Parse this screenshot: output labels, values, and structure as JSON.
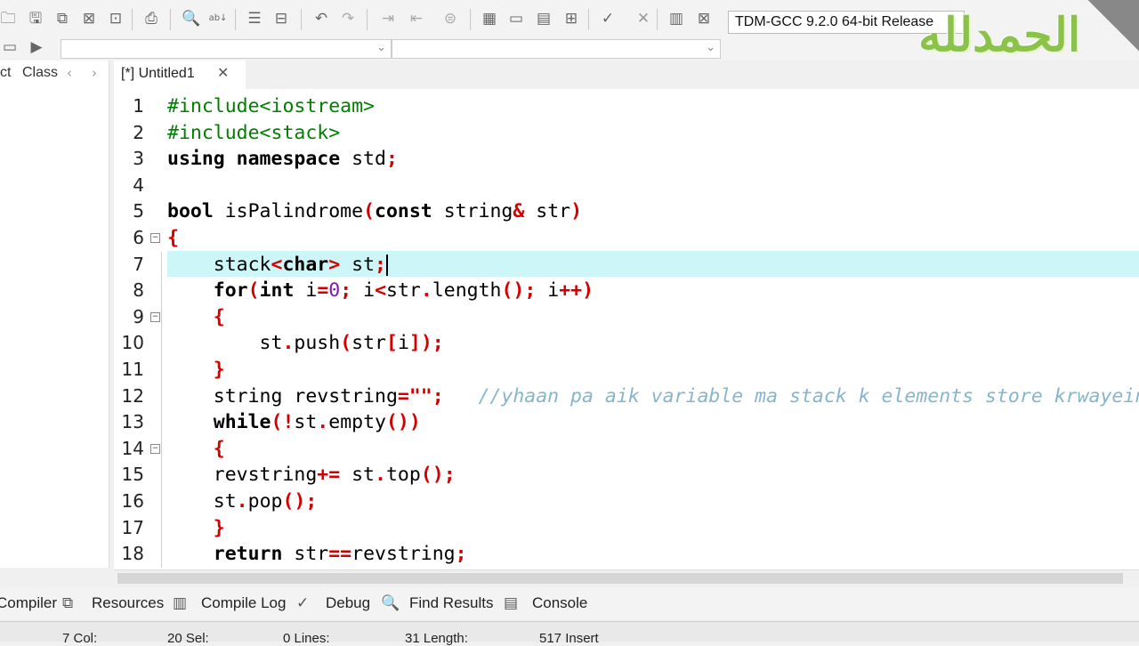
{
  "toolbar": {
    "compiler": "TDM-GCC 9.2.0 64-bit Release",
    "icons": [
      "open-icon",
      "save-icon",
      "save-all-icon",
      "close-icon",
      "close-all-icon",
      "print-icon",
      "find-icon",
      "replace-icon",
      "indent-icon",
      "unindent-icon",
      "undo-icon",
      "redo-icon",
      "new-class-icon",
      "bookmark-icon",
      "goto-icon",
      "layout-icon",
      "layout2-icon",
      "layout3-icon",
      "layout4-icon",
      "check-icon",
      "cancel-icon",
      "chart-icon",
      "debug-icon"
    ]
  },
  "left_panel": {
    "tabs": [
      "ct",
      "Class"
    ]
  },
  "editor": {
    "tab_label": "[*] Untitled1",
    "line_numbers": [
      "1",
      "2",
      "3",
      "4",
      "5",
      "6",
      "7",
      "8",
      "9",
      "10",
      "11",
      "12",
      "13",
      "14",
      "15",
      "16",
      "17",
      "18"
    ],
    "current_line": 7
  },
  "bottom_tabs": [
    "Compiler",
    "Resources",
    "Compile Log",
    "Debug",
    "Find Results",
    "Console"
  ],
  "status": [
    "7 Col:",
    "20 Sel:",
    "0 Lines:",
    "31 Length:",
    "517 Insert"
  ],
  "watermark": "الحمدلله",
  "colors": {
    "keyword": "#000000",
    "symbol": "#d40000",
    "number": "#7b1fa2",
    "comment": "#86b6cc",
    "current_line": "#cdf6f8"
  },
  "code": [
    [
      [
        "#include<iostream>",
        "pp"
      ]
    ],
    [
      [
        "#include<stack>",
        "pp"
      ]
    ],
    [
      [
        "using namespace",
        "kw"
      ],
      [
        " std",
        ""
      ],
      [
        ";",
        "sym"
      ]
    ],
    [],
    [
      [
        "bool",
        "kw"
      ],
      [
        " isPalindrome",
        ""
      ],
      [
        "(",
        "sym"
      ],
      [
        "const",
        "kw"
      ],
      [
        " string",
        ""
      ],
      [
        "&",
        "sym"
      ],
      [
        " str",
        ""
      ],
      [
        ")",
        "sym"
      ]
    ],
    [
      [
        "{",
        "sym"
      ]
    ],
    [
      [
        "    stack",
        ""
      ],
      [
        "<",
        "sym"
      ],
      [
        "char",
        "kw"
      ],
      [
        ">",
        "sym"
      ],
      [
        " st",
        ""
      ],
      [
        ";",
        "sym"
      ]
    ],
    [
      [
        "    ",
        ""
      ],
      [
        "for",
        "kw"
      ],
      [
        "(",
        "sym"
      ],
      [
        "int",
        "kw"
      ],
      [
        " i",
        ""
      ],
      [
        "=",
        "sym"
      ],
      [
        "0",
        "num"
      ],
      [
        ";",
        "sym"
      ],
      [
        " i",
        ""
      ],
      [
        "<",
        "sym"
      ],
      [
        "str",
        ""
      ],
      [
        ".",
        "sym"
      ],
      [
        "length",
        ""
      ],
      [
        "();",
        "sym"
      ],
      [
        " i",
        ""
      ],
      [
        "++)",
        "sym"
      ]
    ],
    [
      [
        "    ",
        ""
      ],
      [
        "{",
        "sym"
      ]
    ],
    [
      [
        "        st",
        ""
      ],
      [
        ".",
        "sym"
      ],
      [
        "push",
        ""
      ],
      [
        "(",
        "sym"
      ],
      [
        "str",
        ""
      ],
      [
        "[",
        "sym"
      ],
      [
        "i",
        ""
      ],
      [
        "]);",
        "sym"
      ]
    ],
    [
      [
        "    ",
        ""
      ],
      [
        "}",
        "sym"
      ]
    ],
    [
      [
        "    string revstring",
        ""
      ],
      [
        "=\"\";",
        "sym"
      ],
      [
        "   //yhaan pa aik variable ma stack k elements store krwayein gay",
        "cm"
      ]
    ],
    [
      [
        "    ",
        ""
      ],
      [
        "while",
        "kw"
      ],
      [
        "(!",
        "sym"
      ],
      [
        "st",
        ""
      ],
      [
        ".",
        "sym"
      ],
      [
        "empty",
        ""
      ],
      [
        "())",
        "sym"
      ]
    ],
    [
      [
        "    ",
        ""
      ],
      [
        "{",
        "sym"
      ]
    ],
    [
      [
        "    revstring",
        ""
      ],
      [
        "+=",
        "sym"
      ],
      [
        " st",
        ""
      ],
      [
        ".",
        "sym"
      ],
      [
        "top",
        ""
      ],
      [
        "();",
        "sym"
      ]
    ],
    [
      [
        "    st",
        ""
      ],
      [
        ".",
        "sym"
      ],
      [
        "pop",
        ""
      ],
      [
        "();",
        "sym"
      ]
    ],
    [
      [
        "    ",
        ""
      ],
      [
        "}",
        "sym"
      ]
    ],
    [
      [
        "    ",
        ""
      ],
      [
        "return",
        "kw"
      ],
      [
        " str",
        ""
      ],
      [
        "==",
        "sym"
      ],
      [
        "revstring",
        ""
      ],
      [
        ";",
        "sym"
      ]
    ]
  ]
}
